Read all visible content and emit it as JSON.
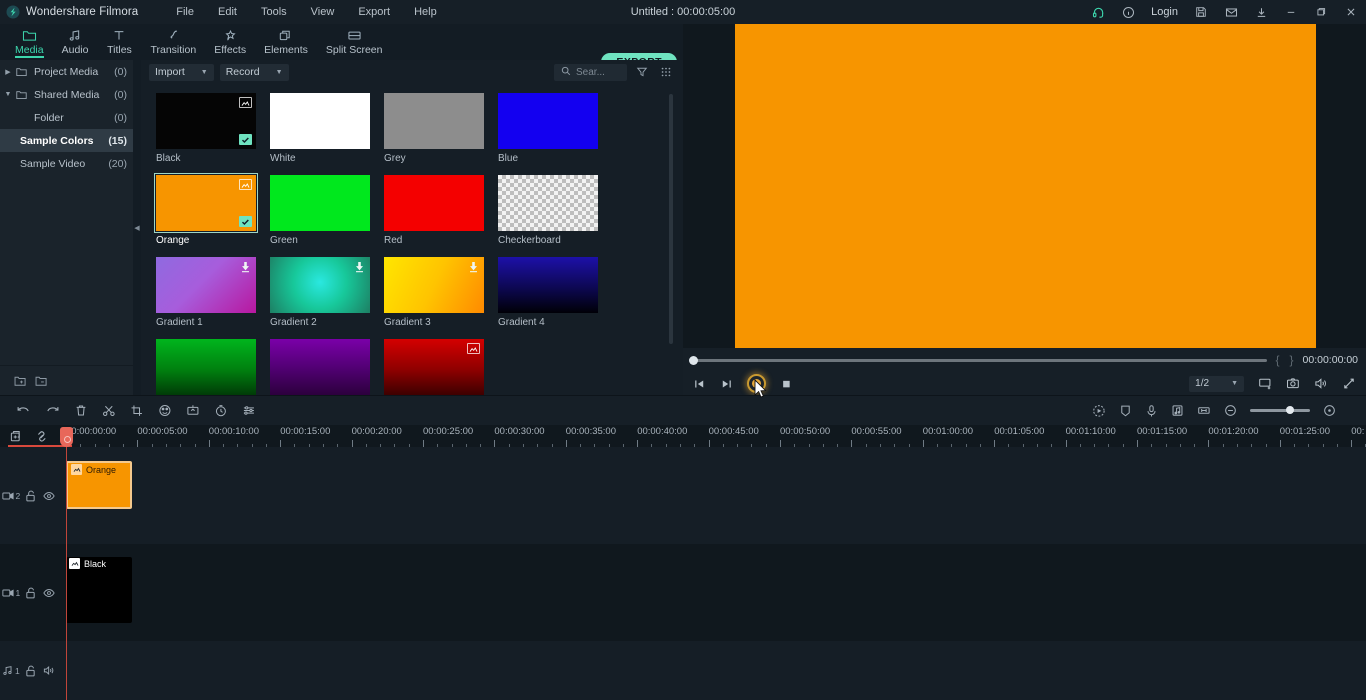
{
  "titlebar": {
    "brand": "Wondershare Filmora",
    "menus": [
      "File",
      "Edit",
      "Tools",
      "View",
      "Export",
      "Help"
    ],
    "document_title": "Untitled : 00:00:05:00",
    "login_label": "Login",
    "right_icons": [
      "headset-icon",
      "info-icon",
      "save-icon",
      "mail-icon",
      "download-icon"
    ],
    "window_controls": [
      "minimize",
      "maximize",
      "close"
    ]
  },
  "tabbar": {
    "tabs": [
      {
        "label": "Media",
        "icon": "folder-icon",
        "active": true
      },
      {
        "label": "Audio",
        "icon": "music-note-icon",
        "active": false
      },
      {
        "label": "Titles",
        "icon": "text-t-icon",
        "active": false
      },
      {
        "label": "Transition",
        "icon": "transition-icon",
        "active": false
      },
      {
        "label": "Effects",
        "icon": "effects-icon",
        "active": false
      },
      {
        "label": "Elements",
        "icon": "elements-icon",
        "active": false
      },
      {
        "label": "Split Screen",
        "icon": "split-screen-icon",
        "active": false
      }
    ],
    "export_label": "EXPORT",
    "export_color": "#6fe3c0"
  },
  "sidebar": {
    "items": [
      {
        "label": "Project Media",
        "count": "(0)",
        "twisty": "right",
        "folder": true,
        "indent": false,
        "selected": false
      },
      {
        "label": "Shared Media",
        "count": "(0)",
        "twisty": "down",
        "folder": true,
        "indent": false,
        "selected": false
      },
      {
        "label": "Folder",
        "count": "(0)",
        "twisty": "",
        "folder": false,
        "indent": true,
        "selected": false
      },
      {
        "label": "Sample Colors",
        "count": "(15)",
        "twisty": "",
        "folder": false,
        "indent": false,
        "selected": true
      },
      {
        "label": "Sample Video",
        "count": "(20)",
        "twisty": "",
        "folder": false,
        "indent": false,
        "selected": false
      }
    ],
    "bottom_icons": [
      "add-folder-icon",
      "remove-folder-icon"
    ]
  },
  "media_toolbar": {
    "import_label": "Import",
    "record_label": "Record",
    "search_placeholder": "Sear...",
    "filter_icon": "filter-icon",
    "grid_icon": "grid-view-icon"
  },
  "media_grid": {
    "rows": [
      [
        {
          "name": "Black",
          "fill": "#050505",
          "kind": "solid",
          "badge_img": true,
          "badge_check": true,
          "badge_dl": false,
          "selected": false
        },
        {
          "name": "White",
          "fill": "#ffffff",
          "kind": "solid",
          "badge_img": false,
          "badge_check": false,
          "badge_dl": false,
          "selected": false
        },
        {
          "name": "Grey",
          "fill": "#8d8d8d",
          "kind": "solid",
          "badge_img": false,
          "badge_check": false,
          "badge_dl": false,
          "selected": false
        },
        {
          "name": "Blue",
          "fill": "#1300f0",
          "kind": "solid",
          "badge_img": false,
          "badge_check": false,
          "badge_dl": false,
          "selected": false
        }
      ],
      [
        {
          "name": "Orange",
          "fill": "#f79500",
          "kind": "solid",
          "badge_img": true,
          "badge_check": true,
          "badge_dl": false,
          "selected": true
        },
        {
          "name": "Green",
          "fill": "#00e81d",
          "kind": "solid",
          "badge_img": false,
          "badge_check": false,
          "badge_dl": false,
          "selected": false
        },
        {
          "name": "Red",
          "fill": "#f40000",
          "kind": "solid",
          "badge_img": false,
          "badge_check": false,
          "badge_dl": false,
          "selected": false
        },
        {
          "name": "Checkerboard",
          "fill": "",
          "kind": "checker",
          "badge_img": false,
          "badge_check": false,
          "badge_dl": false,
          "selected": false
        }
      ],
      [
        {
          "name": "Gradient 1",
          "fill": "linear-gradient(135deg,#8f6ae0 0%,#a75ddc 45%,#b8179f 100%)",
          "kind": "gradient",
          "badge_img": false,
          "badge_check": false,
          "badge_dl": true,
          "selected": false
        },
        {
          "name": "Gradient 2",
          "fill": "radial-gradient(circle at 50% 45%,#2ae8e0 0%,#17c89a 45%,#1d7f63 100%)",
          "kind": "gradient",
          "badge_img": false,
          "badge_check": false,
          "badge_dl": true,
          "selected": false
        },
        {
          "name": "Gradient 3",
          "fill": "linear-gradient(115deg,#ffe600 0%,#ffc400 50%,#ff8a00 100%)",
          "kind": "gradient",
          "badge_img": false,
          "badge_check": false,
          "badge_dl": true,
          "selected": false
        },
        {
          "name": "Gradient 4",
          "fill": "linear-gradient(180deg,#1d10a8 0%,#0d0852 55%,#000006 100%)",
          "kind": "gradient",
          "badge_img": false,
          "badge_check": false,
          "badge_dl": false,
          "selected": false
        }
      ],
      [
        {
          "name": "",
          "fill": "linear-gradient(180deg,#00b51d 0%,#00800f 55%,#003b07 100%)",
          "kind": "gradient",
          "badge_img": false,
          "badge_check": false,
          "badge_dl": false,
          "selected": false
        },
        {
          "name": "",
          "fill": "linear-gradient(180deg,#7a00a8 0%,#4f0070 55%,#2c003d 100%)",
          "kind": "gradient",
          "badge_img": false,
          "badge_check": false,
          "badge_dl": false,
          "selected": false
        },
        {
          "name": "",
          "fill": "linear-gradient(180deg,#d40000 0%,#8e0000 55%,#3d0000 100%)",
          "kind": "gradient",
          "badge_img": true,
          "badge_check": false,
          "badge_dl": false,
          "selected": false
        }
      ]
    ]
  },
  "preview": {
    "canvas_color": "#f79500",
    "seek_value": 0,
    "mark_in_label": "{",
    "mark_out_label": "}",
    "timecode": "00:00:00:00",
    "controls": [
      "step-back-icon",
      "step-forward-icon",
      "record-icon",
      "stop-icon"
    ],
    "ratio_label": "1/2",
    "right_icons": [
      "display-icon",
      "snapshot-icon",
      "volume-icon",
      "fullscreen-icon"
    ]
  },
  "timeline_toolbar": {
    "left_icons": [
      "undo-icon",
      "redo-icon",
      "delete-icon",
      "split-icon",
      "crop-icon",
      "color-icon",
      "green-screen-icon",
      "speed-icon",
      "audio-mix-icon"
    ],
    "right_icons": [
      "motion-tracking-icon",
      "marker-icon",
      "voiceover-icon",
      "audio-beat-icon",
      "fit-timeline-icon"
    ],
    "zoom_out_icon": "zoom-out-icon",
    "zoom_in_icon": "zoom-in-icon",
    "zoom_value": 60
  },
  "timeline": {
    "header_icons": [
      "add-track-icon",
      "link-icon"
    ],
    "ruler_labels": [
      "00:00:00:00",
      "00:00:05:00",
      "00:00:10:00",
      "00:00:15:00",
      "00:00:20:00",
      "00:00:25:00",
      "00:00:30:00",
      "00:00:35:00",
      "00:00:40:00",
      "00:00:45:00",
      "00:00:50:00",
      "00:00:55:00",
      "00:01:00:00",
      "00:01:05:00",
      "00:01:10:00",
      "00:01:15:00",
      "00:01:20:00",
      "00:01:25:00",
      "00:"
    ],
    "playhead_position": "00:00:00:00",
    "tracks": [
      {
        "id": "video-2",
        "label": "2",
        "type": "video",
        "lock": "unlocked",
        "visibility": "eye-icon",
        "clips": [
          {
            "name": "Orange",
            "color": "#f79500",
            "selected": true
          }
        ]
      },
      {
        "id": "video-1",
        "label": "1",
        "type": "video",
        "lock": "unlocked",
        "visibility": "eye-icon",
        "clips": [
          {
            "name": "Black",
            "color": "#000000",
            "selected": false
          }
        ]
      },
      {
        "id": "audio-1",
        "label": "1",
        "type": "audio",
        "lock": "unlocked",
        "visibility": "speaker-icon",
        "clips": []
      }
    ]
  }
}
